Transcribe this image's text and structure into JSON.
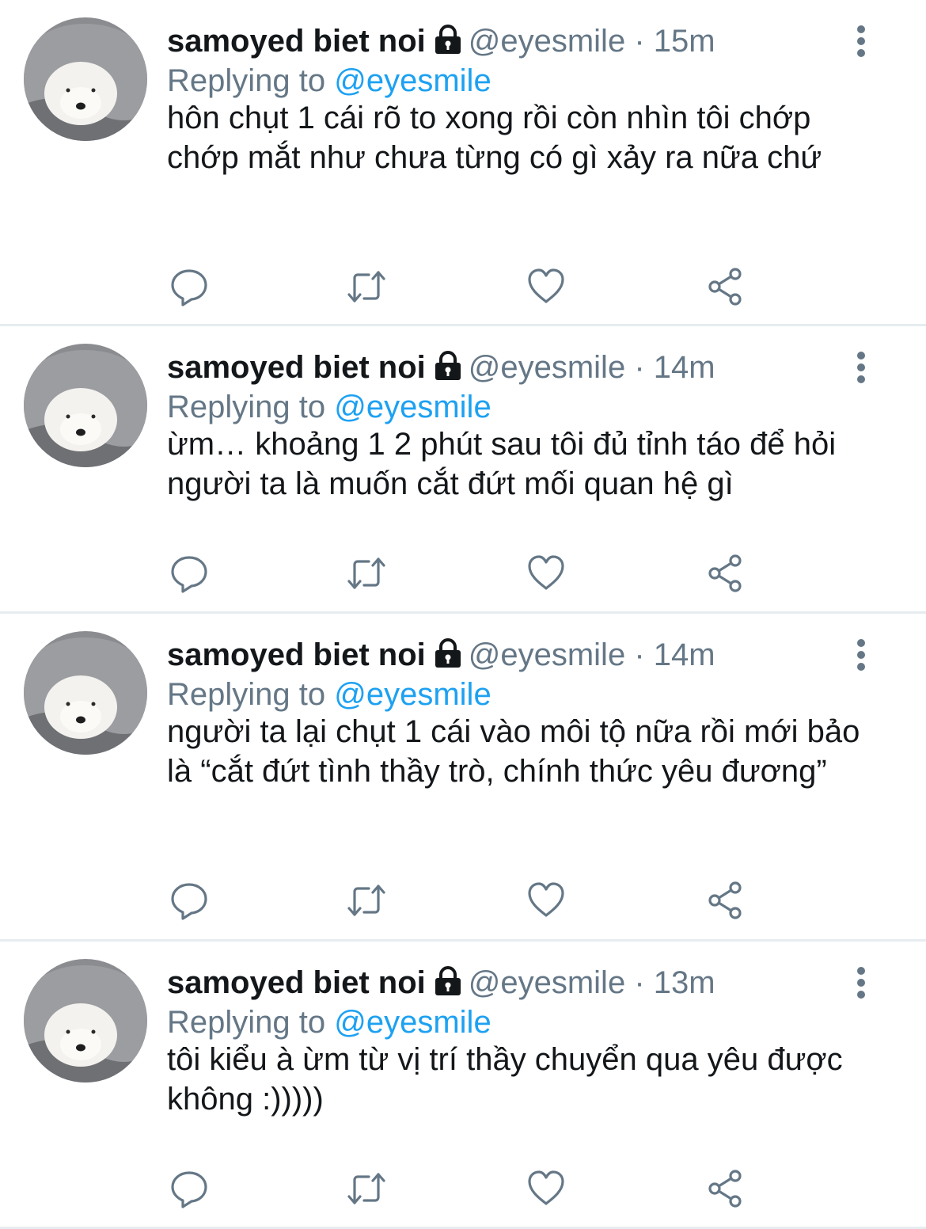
{
  "tweets": [
    {
      "author_name": "samoyed biet noi",
      "handle": "@eyesmile",
      "separator": "·",
      "time": "15m",
      "replying_prefix": "Replying to",
      "replying_to": "@eyesmile",
      "text": "hôn chụt 1 cái rõ to xong rồi còn nhìn tôi chớp chớp mắt như chưa từng có gì xảy ra nữa chứ"
    },
    {
      "author_name": "samoyed biet noi",
      "handle": "@eyesmile",
      "separator": "·",
      "time": "14m",
      "replying_prefix": "Replying to",
      "replying_to": "@eyesmile",
      "text": "ừm… khoảng 1 2 phút sau tôi đủ tỉnh táo để hỏi người ta là muốn cắt đứt mối quan hệ gì"
    },
    {
      "author_name": "samoyed biet noi",
      "handle": "@eyesmile",
      "separator": "·",
      "time": "14m",
      "replying_prefix": "Replying to",
      "replying_to": "@eyesmile",
      "text": "người ta lại chụt 1 cái vào môi tộ nữa rồi mới bảo là “cắt đứt tình thầy trò, chính thức yêu đương”"
    },
    {
      "author_name": "samoyed biet noi",
      "handle": "@eyesmile",
      "separator": "·",
      "time": "13m",
      "replying_prefix": "Replying to",
      "replying_to": "@eyesmile",
      "text": "tôi kiểu à ừm từ vị trí thầy chuyển qua yêu được không :)))))"
    }
  ],
  "colors": {
    "text": "#14171a",
    "secondary": "#657786",
    "accent": "#1da1f2",
    "divider": "#e6ecf0"
  },
  "icons": [
    "lock-icon",
    "more-options-icon",
    "reply-icon",
    "retweet-icon",
    "like-icon",
    "share-icon"
  ]
}
